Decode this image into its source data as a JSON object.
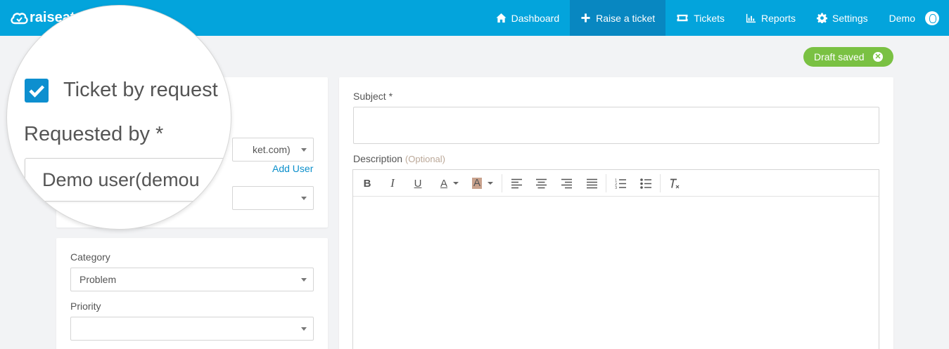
{
  "brand": {
    "name": "raiseat"
  },
  "nav": {
    "items": [
      {
        "label": "Dashboard",
        "icon": "home-icon"
      },
      {
        "label": "Raise a ticket",
        "icon": "plus-icon"
      },
      {
        "label": "Tickets",
        "icon": "ticket-icon"
      },
      {
        "label": "Reports",
        "icon": "bar-chart-icon"
      },
      {
        "label": "Settings",
        "icon": "gear-icon"
      }
    ],
    "active": "Raise a ticket",
    "user": "Demo"
  },
  "draft": {
    "label": "Draft saved"
  },
  "requester": {
    "checkbox_label": "Ticket by request",
    "requested_by_label": "Requested by *",
    "requested_by_value": "Demo user(demou",
    "email_visible": "ket.com)",
    "add_user": "Add User",
    "second_select_value": ""
  },
  "classification": {
    "category_label": "Category",
    "category_value": "Problem",
    "priority_label": "Priority",
    "priority_value": ""
  },
  "ticket": {
    "subject_label": "Subject *",
    "subject_value": "",
    "description_label": "Description",
    "description_optional": "(Optional)"
  },
  "editor_toolbar": [
    "bold-button",
    "italic-button",
    "underline-button",
    "font-color-button",
    "highlight-color-button",
    "align-left-button",
    "align-center-button",
    "align-right-button",
    "justify-button",
    "ordered-list-button",
    "bullet-list-button",
    "clear-format-button"
  ],
  "colors": {
    "header": "#03a4dc",
    "active_nav": "#0887c1",
    "draft": "#7ac143",
    "link": "#0b8fcb"
  }
}
